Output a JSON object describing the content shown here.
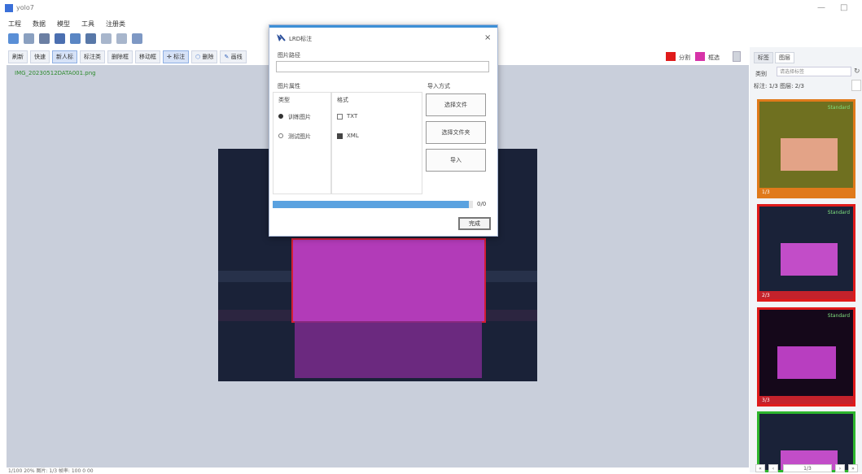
{
  "window": {
    "title": "yolo7",
    "controls": [
      "—",
      "□"
    ]
  },
  "menu": [
    "工程",
    "数据",
    "模型",
    "工具",
    "注册类"
  ],
  "toolbar": {
    "buttons": [
      "刷新",
      "快速",
      "新人标",
      "标注类",
      "删除框",
      "移动框",
      "标注",
      "删除",
      "画线"
    ],
    "active_index": 2,
    "legend": [
      {
        "label": "分割",
        "color": "#e01b1b"
      },
      {
        "label": "框选",
        "color": "#d633a8"
      }
    ]
  },
  "canvas": {
    "filename": "IMG_20230512DATA001.png"
  },
  "dialog": {
    "title": "LRD标注",
    "close": "×",
    "path_label": "图片路径",
    "options_label": "图片属性",
    "col1_header": "类型",
    "col2_header": "格式",
    "radio_options": [
      {
        "label": "训练图片",
        "checked": true
      },
      {
        "label": "测试图片",
        "checked": false
      }
    ],
    "format_options": [
      {
        "label": "TXT",
        "checked": false
      },
      {
        "label": "XML",
        "checked": true
      }
    ],
    "import_label": "导入方式",
    "buttons": [
      "选择文件",
      "选择文件夹",
      "导入"
    ],
    "progress": 0.98,
    "progress_text": "0/0",
    "finish": "完成"
  },
  "right_panel": {
    "tabs": [
      "标签",
      "图层"
    ],
    "active_tab": 1,
    "field_label": "类别",
    "field_placeholder": "请选择标签",
    "row_text": "标注: 1/3  图层: 2/3",
    "thumbnails": [
      {
        "label": "Standard",
        "tag": "1/3",
        "border": "#e07a1b",
        "band": "#e07a1b",
        "bg": "#6f7020",
        "rect_color": "#e3a387"
      },
      {
        "label": "Standard",
        "tag": "2/3",
        "border": "#e01b1b",
        "band": "#c4222b",
        "bg": "#1a2238",
        "rect_color": "#c24dc8"
      },
      {
        "label": "Standard",
        "tag": "3/3",
        "border": "#e01b1b",
        "band": "#c4222b",
        "bg": "#15081a",
        "rect_color": "#b83ec0"
      },
      {
        "label": "",
        "tag": "",
        "border": "#2db52d",
        "band": "#2db52d",
        "bg": "#1a2238",
        "rect_color": "#c24dc8"
      }
    ]
  },
  "statusbar": {
    "text": "1/100  20%  图片: 1/3  帧率: 100  0  00"
  },
  "pager": [
    "«",
    "‹",
    "1/3",
    "›",
    "»"
  ]
}
